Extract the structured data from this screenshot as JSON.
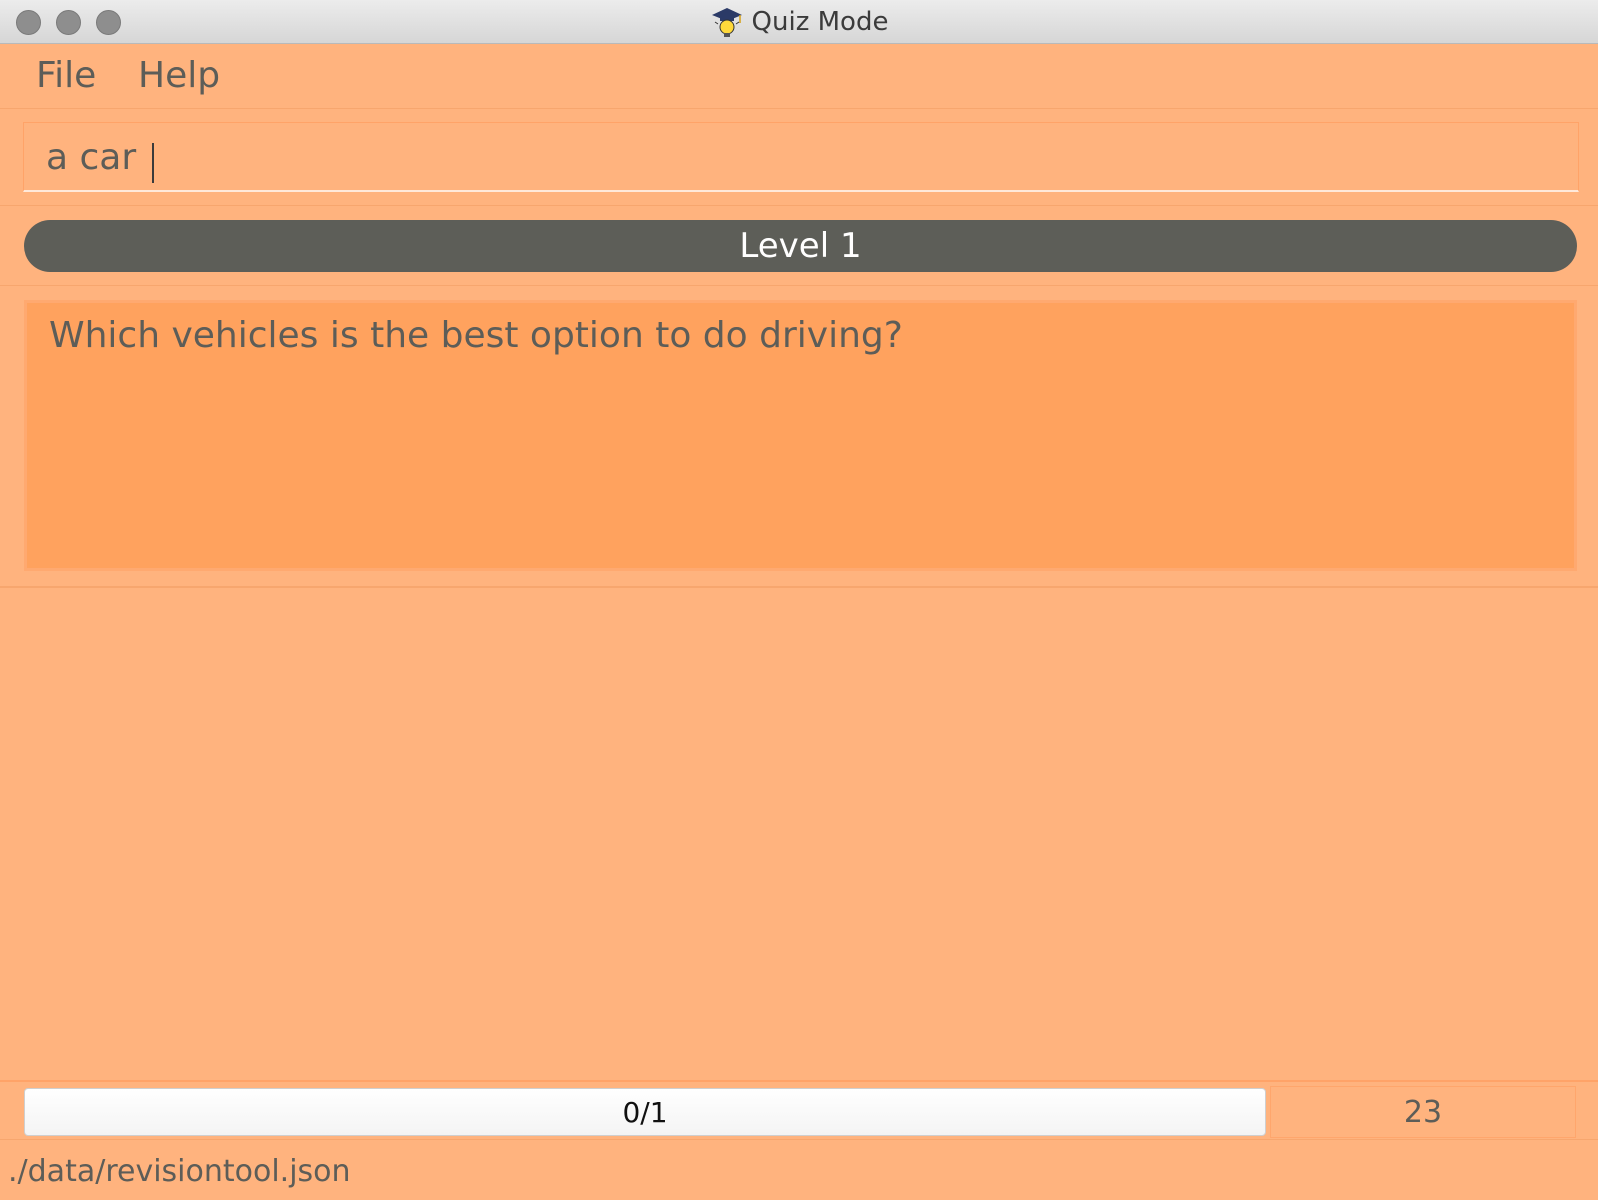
{
  "window": {
    "title": "Quiz Mode",
    "app_icon": "graduation-cap-lightbulb-icon"
  },
  "menu": {
    "items": [
      {
        "label": "File"
      },
      {
        "label": "Help"
      }
    ]
  },
  "command": {
    "value": "a car"
  },
  "level": {
    "label": "Level 1"
  },
  "question": {
    "text": "Which vehicles is the best option to do driving?"
  },
  "progress": {
    "label": "0/1",
    "fraction": 0
  },
  "timer": {
    "value": "23"
  },
  "status": {
    "file_path": "./data/revisiontool.json"
  },
  "colors": {
    "background": "#ffb37e",
    "question_background": "#ffa25e",
    "level_pill": "#5d5e58",
    "text": "#5d5d58"
  }
}
